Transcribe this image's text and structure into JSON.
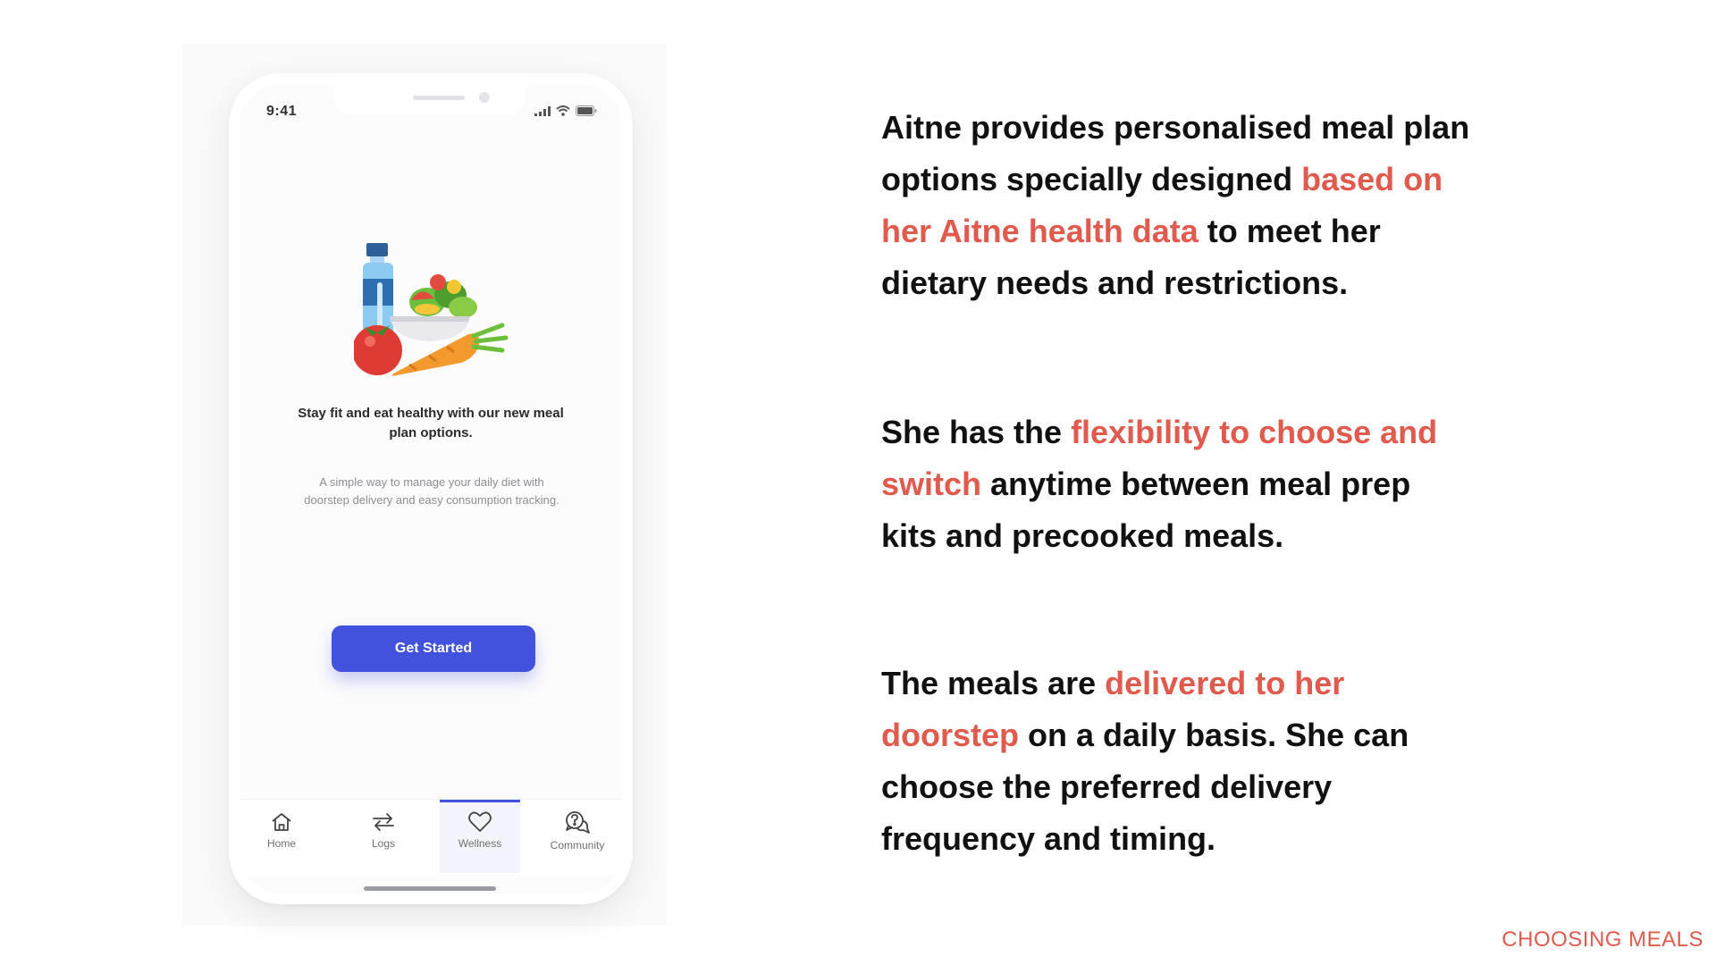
{
  "status_bar": {
    "time": "9:41"
  },
  "onboarding": {
    "headline": "Stay fit and eat healthy with our new meal plan options.",
    "description": "A simple way to manage your daily diet with doorstep delivery and easy consumption tracking.",
    "cta_label": "Get Started",
    "illustration_icon": "meal-plan-illustration"
  },
  "tabs": [
    {
      "label": "Home",
      "icon": "home-icon",
      "active": false
    },
    {
      "label": "Logs",
      "icon": "swap-arrows-icon",
      "active": false
    },
    {
      "label": "Wellness",
      "icon": "heart-icon",
      "active": true
    },
    {
      "label": "Community",
      "icon": "chat-question-icon",
      "active": false
    }
  ],
  "copy": {
    "p1": {
      "t1": "Aitne provides personalised meal plan options specially designed ",
      "h1": "based on her Aitne health data",
      "t2": " to meet her dietary needs and restrictions."
    },
    "p2": {
      "t1": "She has the ",
      "h1": "flexibility to choose and switch",
      "t2": " anytime between meal prep kits and precooked meals."
    },
    "p3": {
      "t1": "The meals are ",
      "h1": "delivered to her doorstep",
      "t2": " on a daily basis. She can choose the preferred delivery frequency and timing."
    }
  },
  "footer_tag": "CHOOSING MEALS",
  "colors": {
    "accent": "#4352dc",
    "highlight": "#e05a4e",
    "text": "#111111"
  }
}
